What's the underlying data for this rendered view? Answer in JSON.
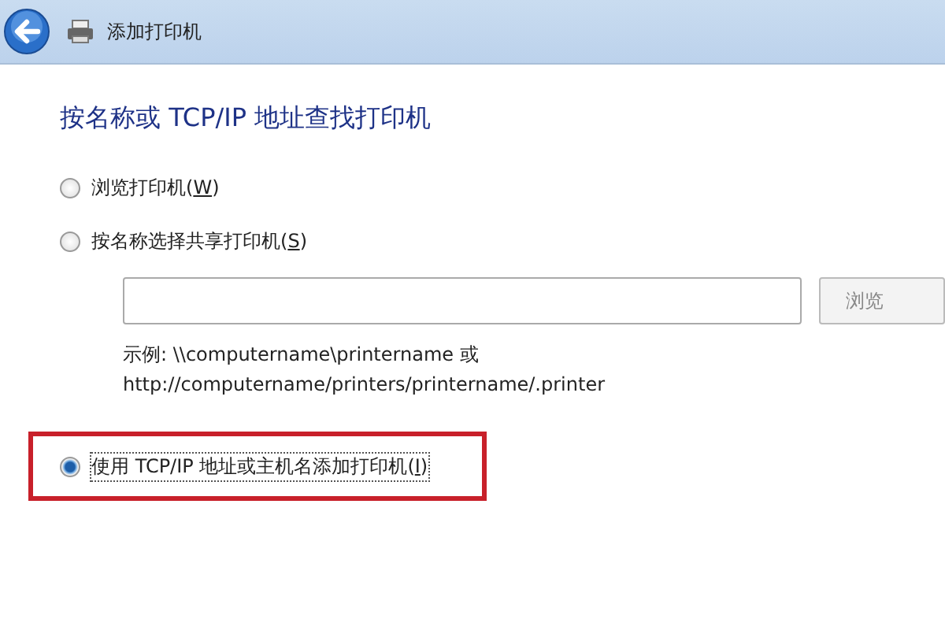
{
  "window": {
    "title": "添加打印机"
  },
  "heading": "按名称或 TCP/IP 地址查找打印机",
  "options": [
    {
      "text": "浏览打印机(",
      "key": "W",
      "after": ")",
      "selected": false,
      "highlighted": false
    },
    {
      "text": "按名称选择共享打印机(",
      "key": "S",
      "after": ")",
      "selected": false,
      "highlighted": false
    },
    {
      "text": "使用 TCP/IP 地址或主机名添加打印机(",
      "key": "I",
      "after": ")",
      "selected": true,
      "highlighted": true
    }
  ],
  "share_field": {
    "browse_button": "浏览",
    "example_lines": [
      "示例: \\\\computername\\printername 或",
      "http://computername/printers/printername/.printer"
    ]
  }
}
